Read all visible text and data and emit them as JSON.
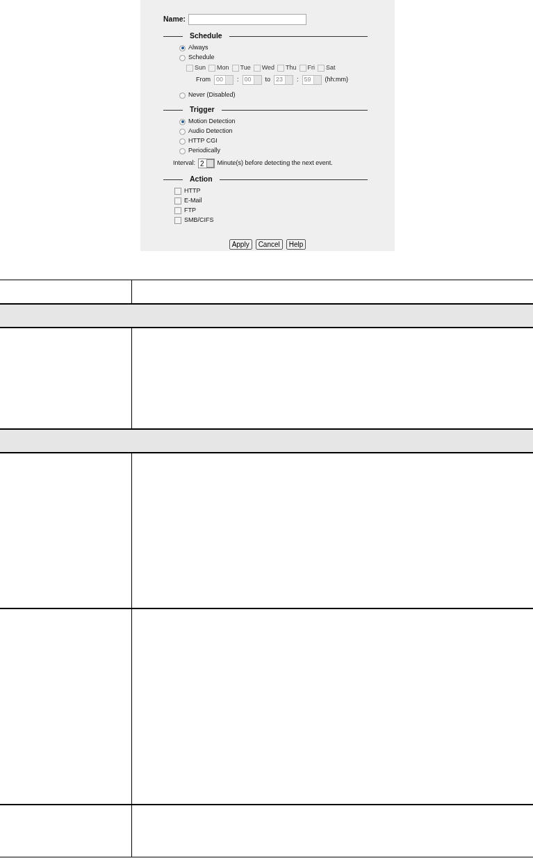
{
  "name_field": {
    "label": "Name:"
  },
  "schedule": {
    "legend": "Schedule",
    "options": [
      {
        "label": "Always",
        "selected": true
      },
      {
        "label": "Schedule",
        "selected": false
      },
      {
        "label": "Never (Disabled)",
        "selected": false
      }
    ],
    "days": [
      {
        "label": "Sun",
        "checked": false
      },
      {
        "label": "Mon",
        "checked": false
      },
      {
        "label": "Tue",
        "checked": false
      },
      {
        "label": "Wed",
        "checked": false
      },
      {
        "label": "Thu",
        "checked": false
      },
      {
        "label": "Fri",
        "checked": false
      },
      {
        "label": "Sat",
        "checked": false
      }
    ],
    "days_disabled": true,
    "time": {
      "from_label": "From",
      "from_hour": "00",
      "separator_1": ":",
      "from_minute": "00",
      "to_label": "to",
      "to_hour": "23",
      "separator_2": ":",
      "to_minute": "59",
      "format": "(hh:mm)",
      "disabled": true
    }
  },
  "trigger": {
    "legend": "Trigger",
    "options": [
      {
        "label": "Motion Detection",
        "selected": true
      },
      {
        "label": "Audio Detection",
        "selected": false
      },
      {
        "label": "HTTP CGI",
        "selected": false
      },
      {
        "label": "Periodically",
        "selected": false
      }
    ],
    "interval": {
      "label": "Interval:",
      "value": "2",
      "suffix": "Minute(s) before detecting the next event."
    }
  },
  "action": {
    "legend": "Action",
    "options": [
      {
        "label": "HTTP",
        "checked": false
      },
      {
        "label": "E-Mail",
        "checked": false
      },
      {
        "label": "FTP",
        "checked": false
      },
      {
        "label": "SMB/CIFS",
        "checked": false
      }
    ]
  },
  "buttons": [
    "Apply",
    "Cancel",
    "Help"
  ],
  "table": {
    "rows": [
      {
        "kind": "header"
      },
      {
        "kind": "section"
      },
      {
        "kind": "entry"
      },
      {
        "kind": "section"
      },
      {
        "kind": "entry"
      },
      {
        "kind": "entry"
      },
      {
        "kind": "entry"
      }
    ]
  }
}
